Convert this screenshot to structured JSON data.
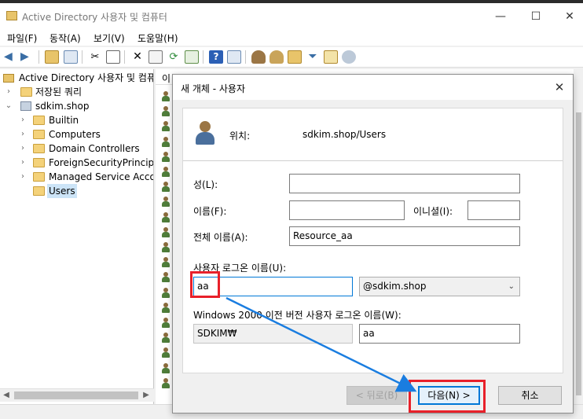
{
  "window": {
    "title": "Active Directory 사용자 및 컴퓨터",
    "minimize": "—",
    "maximize": "☐",
    "close": "✕"
  },
  "menu": [
    "파일(F)",
    "동작(A)",
    "보기(V)",
    "도움말(H)"
  ],
  "tree": {
    "root": "Active Directory 사용자 및 컴퓨",
    "saved_queries": "저장된 쿼리",
    "domain": "sdkim.shop",
    "children": [
      "Builtin",
      "Computers",
      "Domain Controllers",
      "ForeignSecurityPrincipal",
      "Managed Service Accou",
      "Users"
    ],
    "selected": "Users"
  },
  "list": {
    "header_first": "이"
  },
  "dialog": {
    "title": "새 개체 - 사용자",
    "close": "✕",
    "location_label": "위치:",
    "location_value": "sdkim.shop/Users",
    "last_name_label": "성(L):",
    "last_name_value": "",
    "first_name_label": "이름(F):",
    "first_name_value": "",
    "initials_label": "이니셜(I):",
    "initials_value": "",
    "full_name_label": "전체 이름(A):",
    "full_name_value": "Resource_aa",
    "logon_name_label": "사용자 로그온 이름(U):",
    "logon_name_value": "aa",
    "domain_suffix": "@sdkim.shop",
    "pre2000_label": "Windows 2000 이전 버전 사용자 로그온 이름(W):",
    "pre2000_domain": "SDKIM₩",
    "pre2000_name": "aa",
    "back_button": "< 뒤로(B)",
    "next_button": "다음(N) >",
    "cancel_button": "취소"
  },
  "colors": {
    "annotation_red": "#e8202a",
    "annotation_arrow": "#1a7de0",
    "accent": "#0078d7"
  }
}
